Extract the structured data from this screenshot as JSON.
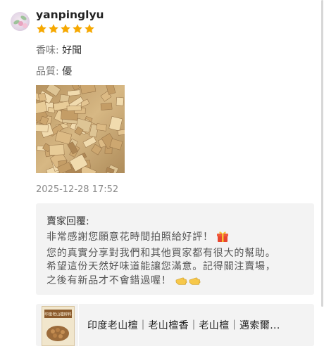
{
  "review": {
    "username": "yanpinglyu",
    "rating": 5,
    "attributes": [
      {
        "key": "香味",
        "sep": ": ",
        "value": "好聞"
      },
      {
        "key": "品質",
        "sep": ": ",
        "value": "優"
      }
    ],
    "date": "2025-12-28 17:52",
    "icons": {
      "rating": "star-icon",
      "avatar": "user-avatar"
    }
  },
  "seller_reply": {
    "title": "賣家回覆:",
    "lines": [
      "非常感謝您願意花時間拍照給好評！",
      "您的真實分享對我們和其他買家都有很大的幫助。",
      "希望這份天然好味道能讓您滿意。記得關注賣場，",
      "之後有新品才不會錯過喔！"
    ],
    "icons": {
      "line1": "gift-icon",
      "line4": "pointing-hands-icon"
    }
  },
  "product": {
    "title": "印度老山檀｜老山檀香｜老山檀｜邁索爾...",
    "thumb_text": "印度老山檀碎料",
    "icon": "product-thumbnail"
  },
  "colors": {
    "star": "#f6a800",
    "reply_bg": "#f3f3f3",
    "date": "#8a8a8a"
  }
}
